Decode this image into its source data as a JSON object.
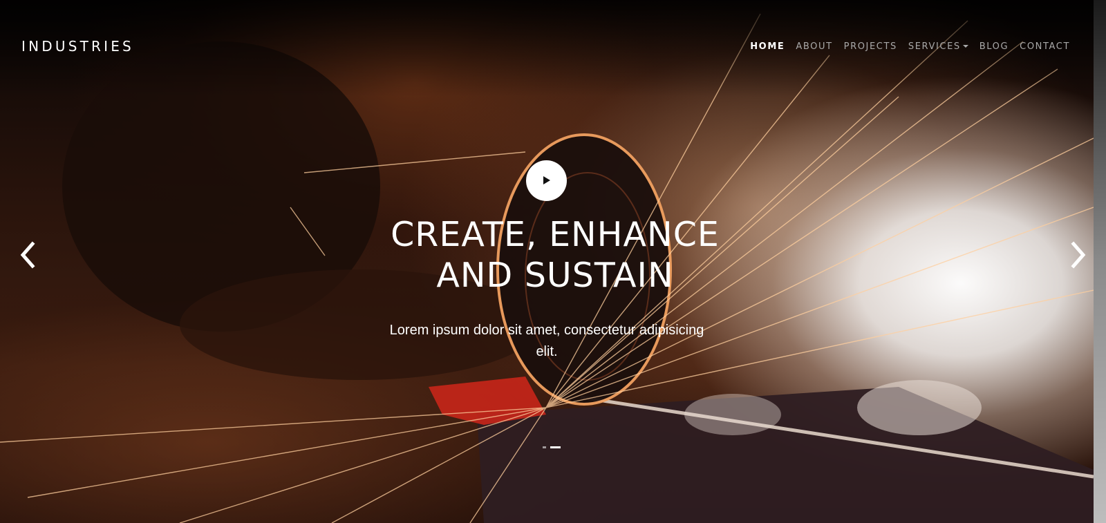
{
  "brand": {
    "name": "INDUSTRIES"
  },
  "nav": {
    "items": [
      {
        "label": "HOME",
        "active": true
      },
      {
        "label": "ABOUT",
        "active": false
      },
      {
        "label": "PROJECTS",
        "active": false
      },
      {
        "label": "SERVICES",
        "active": false,
        "has_dropdown": true
      },
      {
        "label": "BLOG",
        "active": false
      },
      {
        "label": "CONTACT",
        "active": false
      }
    ]
  },
  "hero": {
    "headline_line1": "CREATE, ENHANCE",
    "headline_line2": "AND SUSTAIN",
    "subtext": "Lorem ipsum dolor sit amet, consectetur adipisicing elit.",
    "play_icon": "play-icon",
    "prev_icon": "chevron-left-icon",
    "next_icon": "chevron-right-icon",
    "slides_total": 2,
    "active_slide": 2
  },
  "colors": {
    "text": "#ffffff",
    "nav_inactive": "#a9a9a9",
    "spark_orange": "#ff9a4a"
  }
}
